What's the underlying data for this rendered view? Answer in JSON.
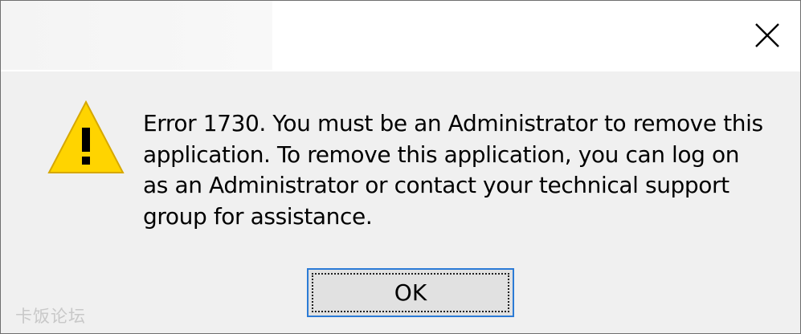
{
  "message": {
    "lines": [
      "Error 1730. You must be an Administrator to remove this",
      "application. To remove this application, you can log on",
      "as an Administrator or contact your technical support",
      "group for assistance."
    ]
  },
  "buttons": {
    "ok_label": "OK",
    "close_icon": "close-icon"
  },
  "icon": {
    "type": "warning-icon",
    "fill": "#ffd400",
    "mark": "#000000"
  },
  "watermark": {
    "text": "卡饭论坛"
  },
  "colors": {
    "dialog_bg": "#f0f0f0",
    "titlebar_bg": "#ffffff",
    "ok_border": "#2b7bd6"
  }
}
